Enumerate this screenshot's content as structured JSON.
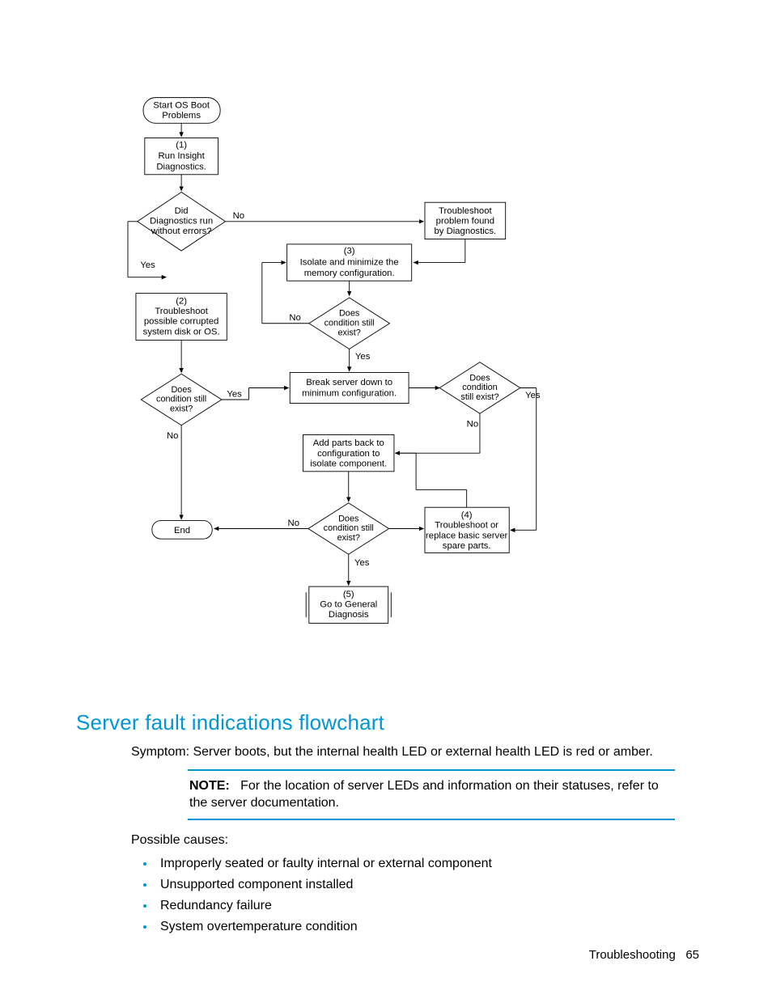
{
  "flowchart": {
    "start": {
      "line1": "Start OS Boot",
      "line2": "Problems"
    },
    "step1": {
      "tag": "(1)",
      "line1": "Run Insight",
      "line2": "Diagnostics."
    },
    "dec1": {
      "line1": "Did",
      "line2": "Diagnostics run",
      "line3": "without errors?"
    },
    "dec1_no": "No",
    "dec1_yes": "Yes",
    "troubleshoot_diag": {
      "line1": "Troubleshoot",
      "line2": "problem found",
      "line3": "by Diagnostics."
    },
    "step2": {
      "tag": "(2)",
      "line1": "Troubleshoot",
      "line2": "possible corrupted",
      "line3": "system disk or OS."
    },
    "step3": {
      "tag": "(3)",
      "line1": "Isolate and minimize the",
      "line2": "memory configuration."
    },
    "dec2": {
      "line1": "Does",
      "line2": "condition still",
      "line3": "exist?"
    },
    "dec2_no": "No",
    "dec2_yes": "Yes",
    "break_down": {
      "line1": "Break server down to",
      "line2": "minimum configuration."
    },
    "add_parts": {
      "line1": "Add parts back to",
      "line2": "configuration to",
      "line3": "isolate component."
    },
    "dec3": {
      "line1": "Does",
      "line2": "condition still",
      "line3": "exist?"
    },
    "dec3_yes": "Yes",
    "dec3_no": "No",
    "dec4": {
      "line1": "Does",
      "line2": "condition",
      "line3": "still exist?"
    },
    "dec4_yes": "Yes",
    "dec4_no": "No",
    "dec5": {
      "line1": "Does",
      "line2": "condition still",
      "line3": "exist?"
    },
    "dec5_no": "No",
    "dec5_yes": "Yes",
    "step4": {
      "tag": "(4)",
      "line1": "Troubleshoot or",
      "line2": "replace basic server",
      "line3": "spare parts."
    },
    "step5": {
      "tag": "(5)",
      "line1": "Go to General",
      "line2": "Diagnosis"
    },
    "end": "End"
  },
  "heading": "Server fault indications flowchart",
  "symptom": "Symptom: Server boots, but the internal health LED or external health LED is red or amber.",
  "note_label": "NOTE:",
  "note_text": "For the location of server LEDs and information on their statuses, refer to the server documentation.",
  "possible_causes_label": "Possible causes:",
  "causes": [
    "Improperly seated or faulty internal or external component",
    "Unsupported component installed",
    "Redundancy failure",
    "System overtemperature condition"
  ],
  "footer_section": "Troubleshooting",
  "footer_page": "65"
}
